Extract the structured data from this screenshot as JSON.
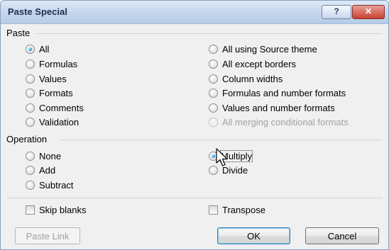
{
  "dialog": {
    "title": "Paste Special",
    "help_glyph": "?",
    "close_glyph": "✕"
  },
  "paste": {
    "label": "Paste",
    "left_options": [
      {
        "label": "All",
        "checked": true
      },
      {
        "label": "Formulas",
        "checked": false
      },
      {
        "label": "Values",
        "checked": false
      },
      {
        "label": "Formats",
        "checked": false
      },
      {
        "label": "Comments",
        "checked": false
      },
      {
        "label": "Validation",
        "checked": false
      }
    ],
    "right_options": [
      {
        "label": "All using Source theme",
        "checked": false,
        "disabled": false
      },
      {
        "label": "All except borders",
        "checked": false,
        "disabled": false
      },
      {
        "label": "Column widths",
        "checked": false,
        "disabled": false
      },
      {
        "label": "Formulas and number formats",
        "checked": false,
        "disabled": false
      },
      {
        "label": "Values and number formats",
        "checked": false,
        "disabled": false
      },
      {
        "label": "All merging conditional formats",
        "checked": false,
        "disabled": true
      }
    ]
  },
  "operation": {
    "label": "Operation",
    "none": "None",
    "add": "Add",
    "subtract": "Subtract",
    "multiply": "Multiply",
    "divide": "Divide",
    "selected": "Multiply"
  },
  "checkboxes": {
    "skip_blanks": {
      "label": "Skip blanks",
      "checked": false
    },
    "transpose": {
      "label": "Transpose",
      "checked": false
    }
  },
  "buttons": {
    "paste_link": "Paste Link",
    "ok": "OK",
    "cancel": "Cancel"
  },
  "colors": {
    "title_bar": "#c6d7ee",
    "close_button": "#c8412f",
    "radio_selected": "#1f8fd1"
  }
}
